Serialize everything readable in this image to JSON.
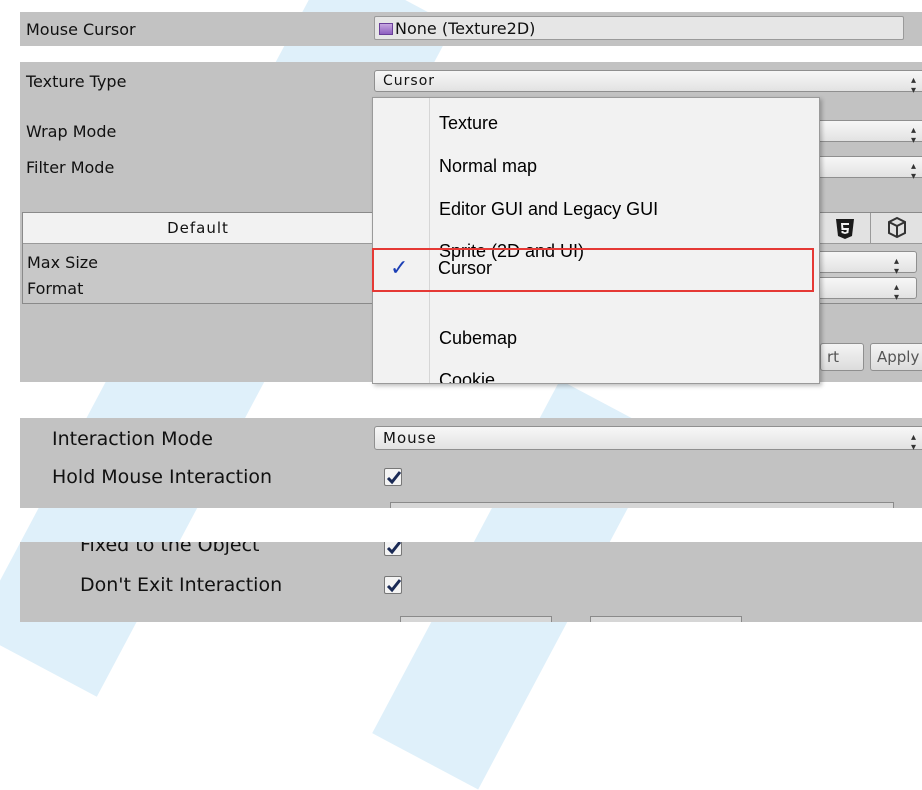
{
  "mouse_cursor": {
    "label": "Mouse Cursor",
    "value": "None (Texture2D)"
  },
  "texture_panel": {
    "texture_type_label": "Texture Type",
    "texture_type_value": "Cursor",
    "wrap_mode_label": "Wrap Mode",
    "filter_mode_label": "Filter Mode",
    "default_tab": "Default",
    "max_size_label": "Max Size",
    "format_label": "Format",
    "revert_partial": "rt",
    "apply_partial": "Apply"
  },
  "dropdown_menu": {
    "items": [
      "Texture",
      "Normal map",
      "Editor GUI and Legacy GUI",
      "Sprite (2D and UI)",
      "Cursor",
      "Cubemap",
      "Cookie"
    ],
    "selected_index": 4,
    "check_glyph": "✓"
  },
  "interaction_panel": {
    "interaction_mode_label": "Interaction Mode",
    "interaction_mode_value": "Mouse",
    "hold_mouse_label": "Hold Mouse Interaction",
    "hold_mouse_checked": true
  },
  "options_panel": {
    "fixed_label": "Fixed to the Object",
    "fixed_checked": true,
    "dont_exit_label": "Don't Exit Interaction",
    "dont_exit_checked": true
  },
  "colors": {
    "panel": "#c2c2c2",
    "highlight": "#e53935",
    "check": "#1c3fb5",
    "stripe": "#dff0fa"
  }
}
